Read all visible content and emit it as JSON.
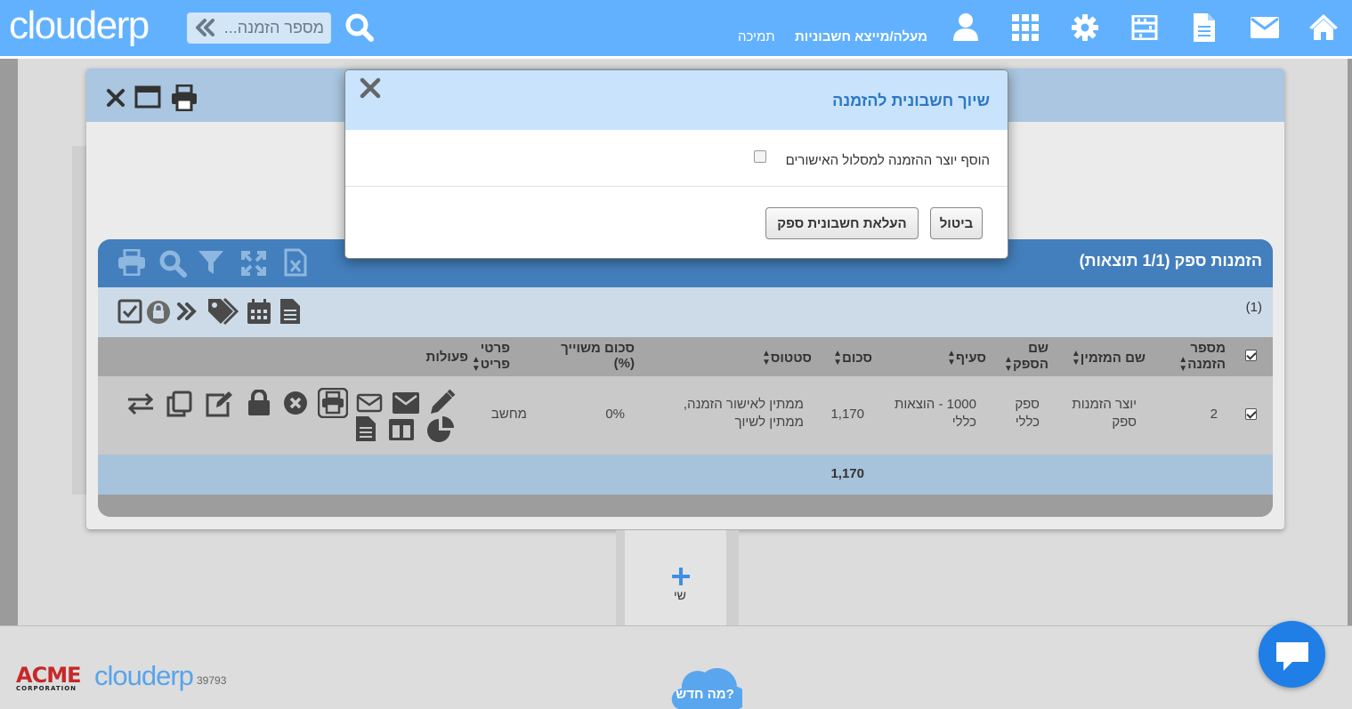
{
  "header": {
    "logo": "clouderp",
    "search_placeholder": "מספר הזמנה...",
    "links": {
      "ap_cycle": "מעלה/מייצא חשבוניות",
      "support": "תמיכה"
    },
    "icons": [
      "home-icon",
      "mail-icon",
      "document-icon",
      "calculator-icon",
      "gear-icon",
      "apps-grid-icon",
      "user-icon"
    ]
  },
  "grid": {
    "title": "הזמנות ספק (1/1 תוצאות)",
    "count": "(1)",
    "columns": {
      "order_no": "מספר הזמנה",
      "orderer": "שם המזמין",
      "supplier": "שם הספק",
      "section": "סעיף",
      "amount": "סכום",
      "status": "סטטוס",
      "assigned_amount": "סכום משוייך (%)",
      "item_details": "פרטי פריט",
      "actions": "פעולות"
    },
    "rows": [
      {
        "order_no": "2",
        "orderer": "יוצר הזמנות ספק",
        "supplier": "ספק כללי",
        "section": "1000 - הוצאות כללי",
        "amount": "1,170",
        "status": "ממתין לאישור הזמנה, ממתין לשיוך",
        "assigned_pct": "0%",
        "item_details": "מחשב"
      }
    ],
    "total": "1,170"
  },
  "add_tab": {
    "label": "שי"
  },
  "modal": {
    "title": "שיוך חשבונית להזמנה",
    "checkbox_label": "הוסף יוצר ההזמנה למסלול האישורים",
    "checkbox_checked": false,
    "upload_button": "העלאת חשבונית ספק",
    "cancel_button": "ביטול"
  },
  "footer": {
    "company_logo": "ACME",
    "company_sub": "CORPORATION",
    "brand_logo": "clouderp",
    "version": "39793",
    "whats_new": "מה חדש?"
  },
  "colors": {
    "topbar": "#62b1ff",
    "grid_title": "#437fbd",
    "modal_header": "#c9e3fc",
    "modal_title": "#2b77c5",
    "chat": "#1f7fe6"
  }
}
